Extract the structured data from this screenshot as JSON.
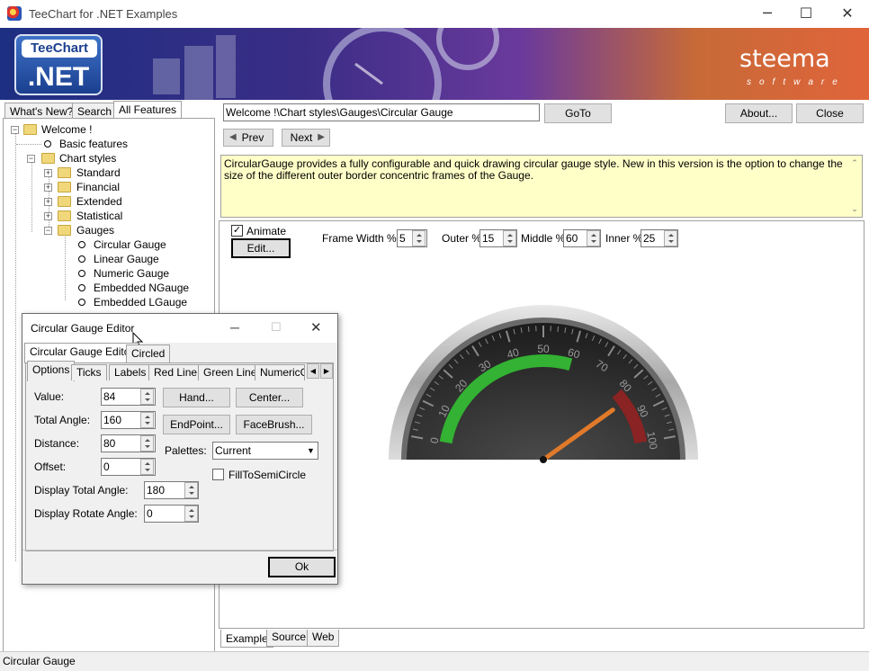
{
  "window": {
    "title": "TeeChart for .NET Examples",
    "minimize": "─",
    "maximize": "☐",
    "close": "✕"
  },
  "banner": {
    "logo_top": "TeeChart",
    "logo_bottom": ".NET",
    "brand": "steema",
    "brand_sub": "software"
  },
  "left_tabs": [
    {
      "label": "What's New?"
    },
    {
      "label": "Search"
    },
    {
      "label": "All Features"
    }
  ],
  "tree": {
    "items": [
      {
        "label": "Welcome !"
      },
      {
        "label": "Basic features"
      },
      {
        "label": "Chart styles"
      },
      {
        "label": "Standard"
      },
      {
        "label": "Financial"
      },
      {
        "label": "Extended"
      },
      {
        "label": "Statistical"
      },
      {
        "label": "Gauges"
      },
      {
        "label": "Circular Gauge"
      },
      {
        "label": "Linear Gauge"
      },
      {
        "label": "Numeric Gauge"
      },
      {
        "label": "Embedded NGauge"
      },
      {
        "label": "Embedded LGauge"
      }
    ]
  },
  "toolbar": {
    "path": "Welcome !\\Chart styles\\Gauges\\Circular Gauge",
    "goto": "GoTo",
    "about": "About...",
    "close": "Close",
    "prev": "Prev",
    "next": "Next"
  },
  "description": "CircularGauge provides a fully configurable and quick drawing circular gauge style. New in this version is the option to change the size of the different outer border concentric frames of the Gauge.",
  "controls": {
    "animate": "Animate",
    "edit": "Edit...",
    "frame": "Frame",
    "width_label": "Width %:",
    "width_value": "5",
    "outer_label": "Outer %",
    "outer_value": "15",
    "middle_label": "Middle %",
    "middle_value": "60",
    "inner_label": "Inner %",
    "inner_value": "25"
  },
  "gauge": {
    "min": 0,
    "max": 100,
    "value": 84,
    "total_angle": 160,
    "ticks": [
      "0",
      "10",
      "20",
      "30",
      "40",
      "50",
      "60",
      "70",
      "80",
      "90",
      "100"
    ],
    "green_range": [
      0,
      60
    ],
    "red_range": [
      80,
      100
    ],
    "colors": {
      "green": "#33b233",
      "red": "#8a2323",
      "needle": "#e07a2a",
      "face": "#2a2a2a"
    }
  },
  "dialog": {
    "title": "Circular Gauge Editor",
    "tabs": [
      {
        "label": "Circular Gauge Editor"
      },
      {
        "label": "Circled"
      }
    ],
    "subtabs": [
      {
        "label": "Options"
      },
      {
        "label": "Ticks"
      },
      {
        "label": "Labels"
      },
      {
        "label": "Red Line"
      },
      {
        "label": "Green Line"
      },
      {
        "label": "NumericGa"
      }
    ],
    "fields": {
      "value_label": "Value:",
      "value": "84",
      "total_angle_label": "Total Angle:",
      "total_angle": "160",
      "distance_label": "Distance:",
      "distance": "80",
      "offset_label": "Offset:",
      "offset": "0",
      "display_total_label": "Display Total Angle:",
      "display_total": "180",
      "display_rotate_label": "Display Rotate Angle:",
      "display_rotate": "0"
    },
    "buttons": {
      "hand": "Hand...",
      "center": "Center...",
      "endpoint": "EndPoint...",
      "facebrush": "FaceBrush...",
      "ok": "Ok"
    },
    "palettes_label": "Palettes:",
    "palettes_value": "Current",
    "fill_semicircle": "FillToSemiCircle"
  },
  "bottom_tabs": [
    {
      "label": "Example"
    },
    {
      "label": "Source"
    },
    {
      "label": "Web"
    }
  ],
  "status": "Circular Gauge"
}
